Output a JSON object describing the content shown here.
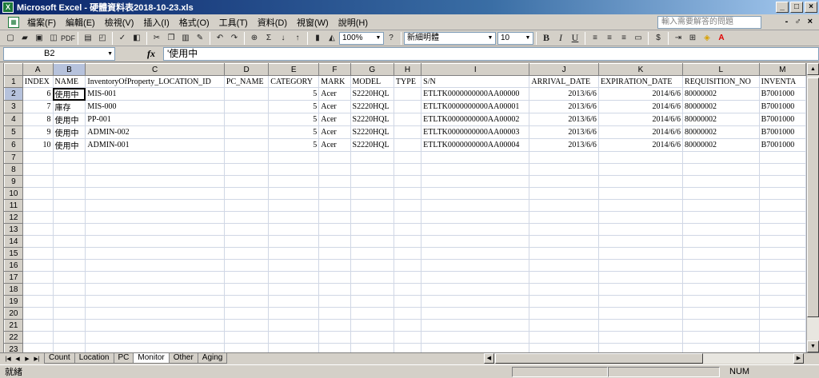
{
  "window": {
    "title": "Microsoft Excel - 硬體資料表2018-10-23.xls",
    "app_icon": "excel-icon",
    "buttons": [
      "_",
      "□",
      "×"
    ]
  },
  "menu": {
    "items": [
      "檔案(F)",
      "編輯(E)",
      "檢視(V)",
      "插入(I)",
      "格式(O)",
      "工具(T)",
      "資料(D)",
      "視窗(W)",
      "說明(H)"
    ],
    "help_placeholder": "輸入需要解答的問題",
    "mdi_buttons": [
      "-",
      "♂",
      "×"
    ]
  },
  "toolbar": {
    "pdf_label": "PDF",
    "zoom": "100%",
    "font_name": "新細明體",
    "font_size": "10",
    "bold": "B",
    "italic": "I",
    "underline": "U",
    "currency": "$",
    "sum": "Σ"
  },
  "formula_bar": {
    "name_box": "B2",
    "fx": "fx",
    "value": "'使用中"
  },
  "grid": {
    "columns": [
      "A",
      "B",
      "C",
      "D",
      "E",
      "F",
      "G",
      "H",
      "I",
      "J",
      "K",
      "L",
      "M"
    ],
    "row_numbers": [
      "1",
      "2",
      "3",
      "4",
      "5",
      "6",
      "7",
      "8",
      "9",
      "10",
      "11",
      "12",
      "13",
      "14",
      "15",
      "16",
      "17",
      "18",
      "19",
      "20",
      "21",
      "22",
      "23"
    ],
    "header_row": [
      "INDEX",
      "NAME",
      "InventoryOfProperty_LOCATION_ID",
      "PC_NAME",
      "CATEGORY",
      "MARK",
      "MODEL",
      "TYPE",
      "S/N",
      "ARRIVAL_DATE",
      "EXPIRATION_DATE",
      "REQUISITION_NO",
      "INVENTA"
    ],
    "data_rows": [
      [
        "6",
        "使用中",
        "MIS-001",
        "",
        "5",
        "Acer",
        "S2220HQL",
        "",
        "ETLTK0000000000AA00000",
        "2013/6/6",
        "2014/6/6",
        "80000002",
        "B7001000"
      ],
      [
        "7",
        "庫存",
        "MIS-000",
        "",
        "5",
        "Acer",
        "S2220HQL",
        "",
        "ETLTK0000000000AA00001",
        "2013/6/6",
        "2014/6/6",
        "80000002",
        "B7001000"
      ],
      [
        "8",
        "使用中",
        "PP-001",
        "",
        "5",
        "Acer",
        "S2220HQL",
        "",
        "ETLTK0000000000AA00002",
        "2013/6/6",
        "2014/6/6",
        "80000002",
        "B7001000"
      ],
      [
        "9",
        "使用中",
        "ADMIN-002",
        "",
        "5",
        "Acer",
        "S2220HQL",
        "",
        "ETLTK0000000000AA00003",
        "2013/6/6",
        "2014/6/6",
        "80000002",
        "B7001000"
      ],
      [
        "10",
        "使用中",
        "ADMIN-001",
        "",
        "5",
        "Acer",
        "S2220HQL",
        "",
        "ETLTK0000000000AA00004",
        "2013/6/6",
        "2014/6/6",
        "80000002",
        "B7001000"
      ]
    ],
    "numeric_columns": [
      0,
      4,
      9,
      10
    ]
  },
  "sheet_tabs": {
    "tabs": [
      "Count",
      "Location",
      "PC",
      "Monitor",
      "Other",
      "Aging"
    ],
    "active": "Monitor"
  },
  "status": {
    "ready": "就緒",
    "num": "NUM"
  }
}
